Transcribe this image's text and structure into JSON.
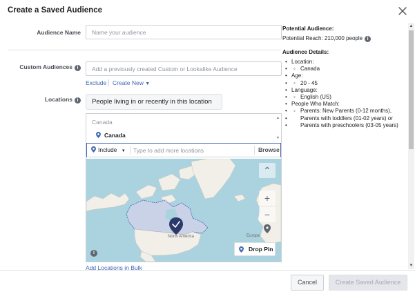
{
  "dialog": {
    "title": "Create a Saved Audience",
    "close_icon": "close-icon"
  },
  "audience_name": {
    "label": "Audience Name",
    "placeholder": "Name your audience",
    "value": ""
  },
  "custom_audiences": {
    "label": "Custom Audiences",
    "placeholder": "Add a previously created Custom or Lookalike Audience",
    "exclude_label": "Exclude",
    "create_new_label": "Create New"
  },
  "locations": {
    "label": "Locations",
    "mode_selected": "People living in or recently in this location",
    "group_header": "Canada",
    "selected_item": "Canada",
    "include_label": "Include",
    "search_placeholder": "Type to add more locations",
    "browse_label": "Browse",
    "map_labels": {
      "north_america": "North America",
      "europe": "Europe"
    },
    "drop_pin_label": "Drop Pin",
    "bulk_link": "Add Locations in Bulk"
  },
  "summary": {
    "potential_heading": "Potential Audience:",
    "potential_reach": "Potential Reach: 210,000 people",
    "details_heading": "Audience Details:",
    "location_label": "Location:",
    "location_value": "Canada",
    "age_label": "Age:",
    "age_value": "20 - 45",
    "language_label": "Language:",
    "language_value": "English (US)",
    "people_label": "People Who Match:",
    "people_value_1": "Parents: New Parents (0-12 months),",
    "people_value_2": "Parents with toddlers (01-02 years) or",
    "people_value_3": "Parents with preschoolers (03-05 years)"
  },
  "footer": {
    "cancel_label": "Cancel",
    "create_label": "Create Saved Audience"
  },
  "colors": {
    "accent": "#4267b2",
    "water": "#aad3df",
    "land": "#f2efe9",
    "selected_region": "#c9d2e6",
    "disabled_button": "#e4e6eb"
  }
}
